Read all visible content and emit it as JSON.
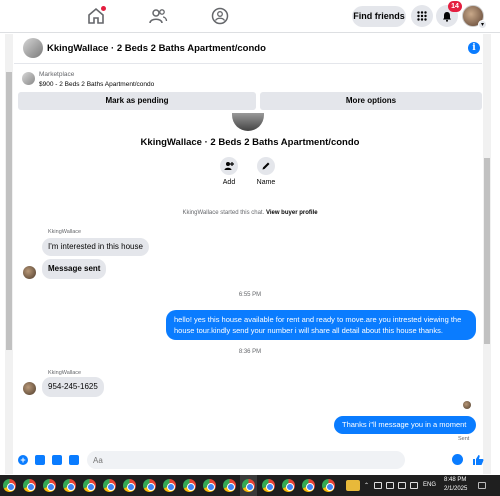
{
  "nav": {
    "find_friends": "Find friends",
    "notification_count": "14"
  },
  "chat": {
    "title": "KkingWallace · 2 Beds 2 Baths Apartment/condo",
    "marketplace_label": "Marketplace",
    "listing": "$900 - 2 Beds 2 Baths Apartment/condo",
    "mark_pending": "Mark as pending",
    "more_options": "More options",
    "profile_name": "KkingWallace · 2 Beds 2 Baths Apartment/condo",
    "add_label": "Add",
    "name_label": "Name",
    "started_text": "KkingWallace started this chat.",
    "view_profile": "View buyer profile"
  },
  "messages": {
    "sender1": "KkingWallace",
    "msg1": "I'm interested in this house",
    "msg2": "Message sent",
    "time1": "6:55 PM",
    "out1": "hello! yes this house available for rent and ready to move.are you intrested viewing the house tour.kindly send your number i will share all detail about this house thanks.",
    "time2": "8:36 PM",
    "sender2": "KkingWallace",
    "msg3": "954-245-1625",
    "out2": "Thanks i\"ll message you in a moment",
    "sent": "Sent"
  },
  "composer": {
    "placeholder": "Aa"
  },
  "taskbar": {
    "lang": "ENG",
    "time": "8:48 PM",
    "date": "2/1/2025"
  },
  "colors": {
    "messenger_blue": "#0a7cff",
    "bubble_gray": "#e4e6eb",
    "badge_red": "#e41e3f"
  }
}
